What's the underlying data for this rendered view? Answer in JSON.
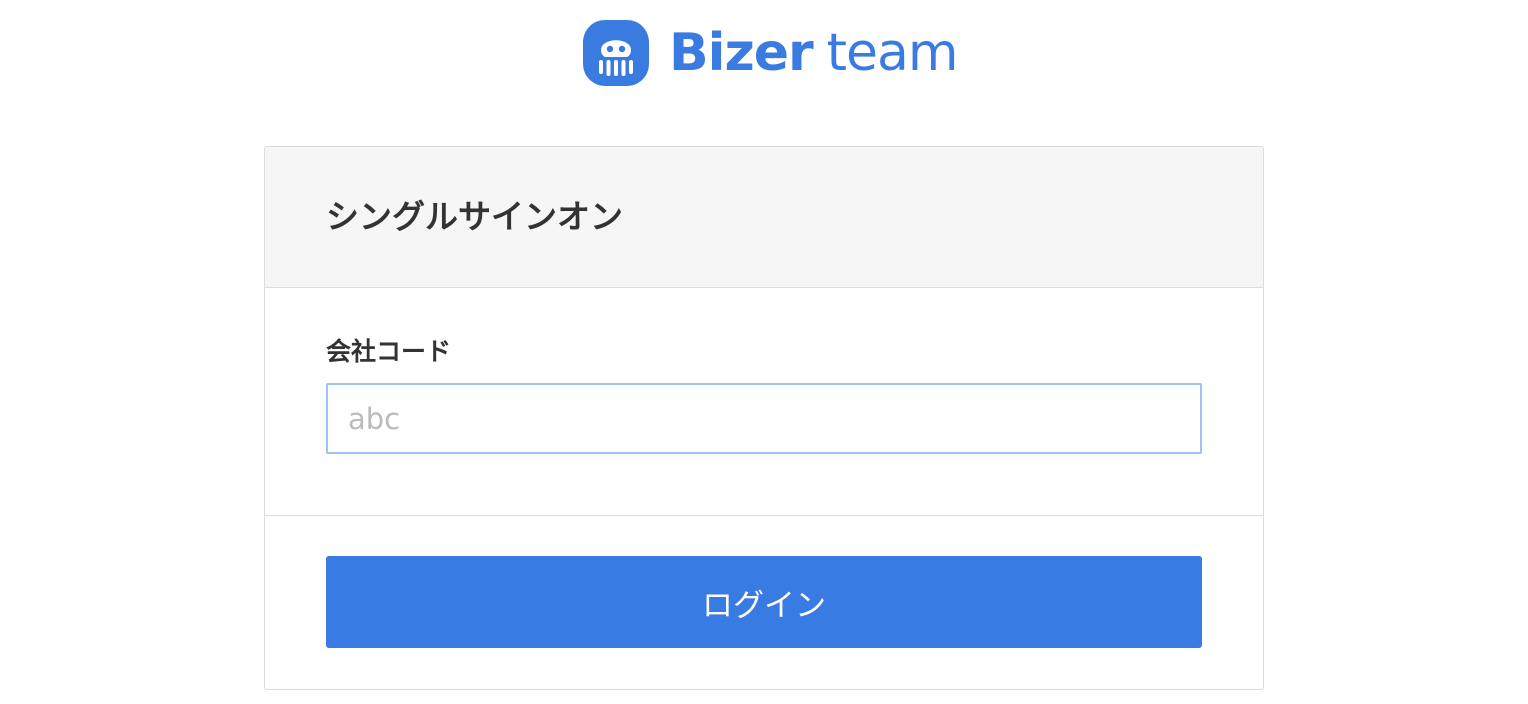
{
  "logo": {
    "brand": "Bizer",
    "suffix": "team",
    "icon": "octopus-logo-icon",
    "color": "#3a7be2"
  },
  "sso": {
    "title": "シングルサインオン",
    "company_code": {
      "label": "会社コード",
      "value": "",
      "placeholder": "abc"
    },
    "login_label": "ログイン"
  },
  "colors": {
    "accent": "#377be3",
    "input_focus_border": "#9dc4f2",
    "header_bg": "#f6f6f6",
    "border": "#dcdcdc",
    "text": "#333333"
  }
}
